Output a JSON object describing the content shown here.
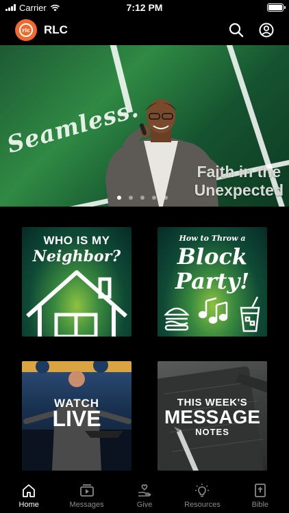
{
  "status_bar": {
    "carrier": "Carrier",
    "time": "7:12 PM",
    "battery_level": 1.0
  },
  "header": {
    "logo_text": "rlc",
    "title": "RLC",
    "icons": [
      "search-icon",
      "profile-icon"
    ]
  },
  "hero": {
    "brand_text": "Seamless.",
    "tagline_line1": "Faith in the",
    "tagline_line2": "Unexpected",
    "slide_count": 5,
    "active_slide": 1
  },
  "tiles": [
    {
      "line1": "WHO IS MY",
      "line2": "Neighbor?"
    },
    {
      "line1": "How to Throw a",
      "line2": "Block",
      "line3": "Party!"
    },
    {
      "line1": "WATCH",
      "line2": "LIVE"
    },
    {
      "line1": "THIS WEEK'S",
      "line2": "MESSAGE",
      "line3": "NOTES"
    }
  ],
  "tab_bar": {
    "active": "Home",
    "tabs": [
      {
        "label": "Home",
        "icon": "home-icon"
      },
      {
        "label": "Messages",
        "icon": "video-icon"
      },
      {
        "label": "Give",
        "icon": "give-icon"
      },
      {
        "label": "Resources",
        "icon": "lightbulb-icon"
      },
      {
        "label": "Bible",
        "icon": "bible-icon"
      }
    ]
  },
  "colors": {
    "brand_orange": "#ef6a2c",
    "background": "#000000",
    "tab_inactive": "#8a8a8a"
  }
}
